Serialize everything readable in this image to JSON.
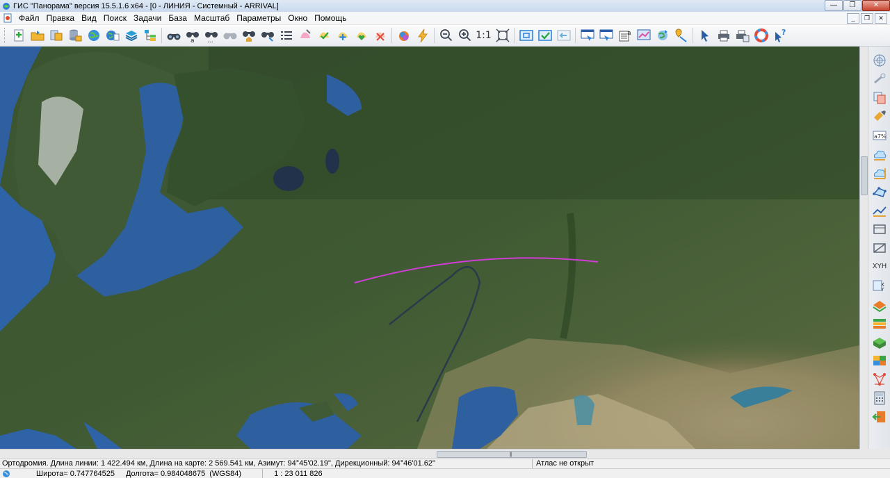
{
  "window": {
    "title": "ГИС \"Панорама\" версия 15.5.1.6 x64 - [0 - ЛИНИЯ - Системный - ARRIVAL]",
    "minimize_glyph": "—",
    "restore_glyph": "❐",
    "close_glyph": "✕"
  },
  "menu": {
    "items": [
      "Файл",
      "Правка",
      "Вид",
      "Поиск",
      "Задачи",
      "База",
      "Масштаб",
      "Параметры",
      "Окно",
      "Помощь"
    ],
    "mdi_minimize": "_",
    "mdi_restore": "❐",
    "mdi_close": "✕"
  },
  "toolbar": {
    "scale_1to1_label": "1:1",
    "icons": [
      "new-map-icon",
      "open-folder-icon",
      "open-layers-icon",
      "database-icon",
      "globe-icon",
      "world-map-icon",
      "layers-icon",
      "layer-tree-icon",
      "binoculars-icon",
      "binoculars-text-icon",
      "binoculars-more-icon",
      "binoculars-disabled-icon",
      "binoculars-house-icon",
      "binoculars-select-icon",
      "list-icon",
      "object-edit-icon",
      "object-check-icon",
      "object-add-icon",
      "object-heart-icon",
      "object-delete-icon",
      "color-palette-icon",
      "lightning-icon",
      "zoom-out-icon",
      "zoom-in-icon",
      "zoom-extent-icon",
      "frame-icon",
      "check-frame-icon",
      "arrow-back-icon",
      "window-select-icon",
      "window-edit-icon",
      "object-info-icon",
      "object-highlight-icon",
      "globe-sync-icon",
      "pin-route-icon",
      "pointer-icon",
      "print-icon",
      "print-settings-icon",
      "color-wheel-icon",
      "help-pointer-icon"
    ]
  },
  "right_toolbar": {
    "xy_label": "XYH",
    "icons": [
      "compass-icon",
      "measure-icon",
      "copy-icon",
      "flashlight-icon",
      "percent-icon",
      "cloud-icon",
      "cloud-edit-icon",
      "polygon-icon",
      "polyline-icon",
      "rectangle-icon",
      "diagonal-icon",
      "xyh-icon",
      "coordinates-icon",
      "terrain-icon",
      "terrain-layers-icon",
      "3d-model-icon",
      "matrix-icon",
      "network-icon",
      "calculator-icon",
      "exit-icon"
    ]
  },
  "status": {
    "main": "Ортодромия. Длина линии: 1 422.494 км, Длина на карте: 2 569.541 км, Азимут: 94°45'02.19\", Дирекционный: 94°46'01.62\"",
    "atlas": "Атлас не открыт",
    "latitude": "Широта= 0.747764525",
    "longitude": "Долгота= 0.984048675",
    "datum": "(WGS84)",
    "scale": "1 : 23 011 826"
  },
  "map": {
    "line_color": "#d03cd6",
    "water_color": "#2e5f9e",
    "sea_color": "#2f63a8",
    "land_color": "#3d5631",
    "steppe_color": "#8a8460"
  },
  "colors": {
    "accent": "#3c7fd1"
  }
}
